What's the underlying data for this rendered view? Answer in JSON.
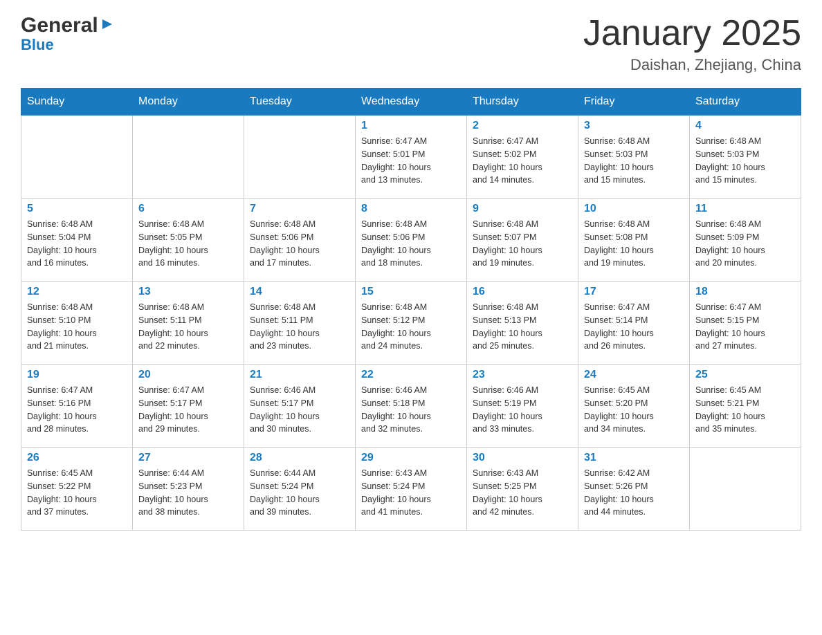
{
  "header": {
    "logo_general": "General",
    "logo_blue": "Blue",
    "title": "January 2025",
    "subtitle": "Daishan, Zhejiang, China"
  },
  "weekdays": [
    "Sunday",
    "Monday",
    "Tuesday",
    "Wednesday",
    "Thursday",
    "Friday",
    "Saturday"
  ],
  "weeks": [
    [
      {
        "day": "",
        "info": ""
      },
      {
        "day": "",
        "info": ""
      },
      {
        "day": "",
        "info": ""
      },
      {
        "day": "1",
        "info": "Sunrise: 6:47 AM\nSunset: 5:01 PM\nDaylight: 10 hours\nand 13 minutes."
      },
      {
        "day": "2",
        "info": "Sunrise: 6:47 AM\nSunset: 5:02 PM\nDaylight: 10 hours\nand 14 minutes."
      },
      {
        "day": "3",
        "info": "Sunrise: 6:48 AM\nSunset: 5:03 PM\nDaylight: 10 hours\nand 15 minutes."
      },
      {
        "day": "4",
        "info": "Sunrise: 6:48 AM\nSunset: 5:03 PM\nDaylight: 10 hours\nand 15 minutes."
      }
    ],
    [
      {
        "day": "5",
        "info": "Sunrise: 6:48 AM\nSunset: 5:04 PM\nDaylight: 10 hours\nand 16 minutes."
      },
      {
        "day": "6",
        "info": "Sunrise: 6:48 AM\nSunset: 5:05 PM\nDaylight: 10 hours\nand 16 minutes."
      },
      {
        "day": "7",
        "info": "Sunrise: 6:48 AM\nSunset: 5:06 PM\nDaylight: 10 hours\nand 17 minutes."
      },
      {
        "day": "8",
        "info": "Sunrise: 6:48 AM\nSunset: 5:06 PM\nDaylight: 10 hours\nand 18 minutes."
      },
      {
        "day": "9",
        "info": "Sunrise: 6:48 AM\nSunset: 5:07 PM\nDaylight: 10 hours\nand 19 minutes."
      },
      {
        "day": "10",
        "info": "Sunrise: 6:48 AM\nSunset: 5:08 PM\nDaylight: 10 hours\nand 19 minutes."
      },
      {
        "day": "11",
        "info": "Sunrise: 6:48 AM\nSunset: 5:09 PM\nDaylight: 10 hours\nand 20 minutes."
      }
    ],
    [
      {
        "day": "12",
        "info": "Sunrise: 6:48 AM\nSunset: 5:10 PM\nDaylight: 10 hours\nand 21 minutes."
      },
      {
        "day": "13",
        "info": "Sunrise: 6:48 AM\nSunset: 5:11 PM\nDaylight: 10 hours\nand 22 minutes."
      },
      {
        "day": "14",
        "info": "Sunrise: 6:48 AM\nSunset: 5:11 PM\nDaylight: 10 hours\nand 23 minutes."
      },
      {
        "day": "15",
        "info": "Sunrise: 6:48 AM\nSunset: 5:12 PM\nDaylight: 10 hours\nand 24 minutes."
      },
      {
        "day": "16",
        "info": "Sunrise: 6:48 AM\nSunset: 5:13 PM\nDaylight: 10 hours\nand 25 minutes."
      },
      {
        "day": "17",
        "info": "Sunrise: 6:47 AM\nSunset: 5:14 PM\nDaylight: 10 hours\nand 26 minutes."
      },
      {
        "day": "18",
        "info": "Sunrise: 6:47 AM\nSunset: 5:15 PM\nDaylight: 10 hours\nand 27 minutes."
      }
    ],
    [
      {
        "day": "19",
        "info": "Sunrise: 6:47 AM\nSunset: 5:16 PM\nDaylight: 10 hours\nand 28 minutes."
      },
      {
        "day": "20",
        "info": "Sunrise: 6:47 AM\nSunset: 5:17 PM\nDaylight: 10 hours\nand 29 minutes."
      },
      {
        "day": "21",
        "info": "Sunrise: 6:46 AM\nSunset: 5:17 PM\nDaylight: 10 hours\nand 30 minutes."
      },
      {
        "day": "22",
        "info": "Sunrise: 6:46 AM\nSunset: 5:18 PM\nDaylight: 10 hours\nand 32 minutes."
      },
      {
        "day": "23",
        "info": "Sunrise: 6:46 AM\nSunset: 5:19 PM\nDaylight: 10 hours\nand 33 minutes."
      },
      {
        "day": "24",
        "info": "Sunrise: 6:45 AM\nSunset: 5:20 PM\nDaylight: 10 hours\nand 34 minutes."
      },
      {
        "day": "25",
        "info": "Sunrise: 6:45 AM\nSunset: 5:21 PM\nDaylight: 10 hours\nand 35 minutes."
      }
    ],
    [
      {
        "day": "26",
        "info": "Sunrise: 6:45 AM\nSunset: 5:22 PM\nDaylight: 10 hours\nand 37 minutes."
      },
      {
        "day": "27",
        "info": "Sunrise: 6:44 AM\nSunset: 5:23 PM\nDaylight: 10 hours\nand 38 minutes."
      },
      {
        "day": "28",
        "info": "Sunrise: 6:44 AM\nSunset: 5:24 PM\nDaylight: 10 hours\nand 39 minutes."
      },
      {
        "day": "29",
        "info": "Sunrise: 6:43 AM\nSunset: 5:24 PM\nDaylight: 10 hours\nand 41 minutes."
      },
      {
        "day": "30",
        "info": "Sunrise: 6:43 AM\nSunset: 5:25 PM\nDaylight: 10 hours\nand 42 minutes."
      },
      {
        "day": "31",
        "info": "Sunrise: 6:42 AM\nSunset: 5:26 PM\nDaylight: 10 hours\nand 44 minutes."
      },
      {
        "day": "",
        "info": ""
      }
    ]
  ]
}
